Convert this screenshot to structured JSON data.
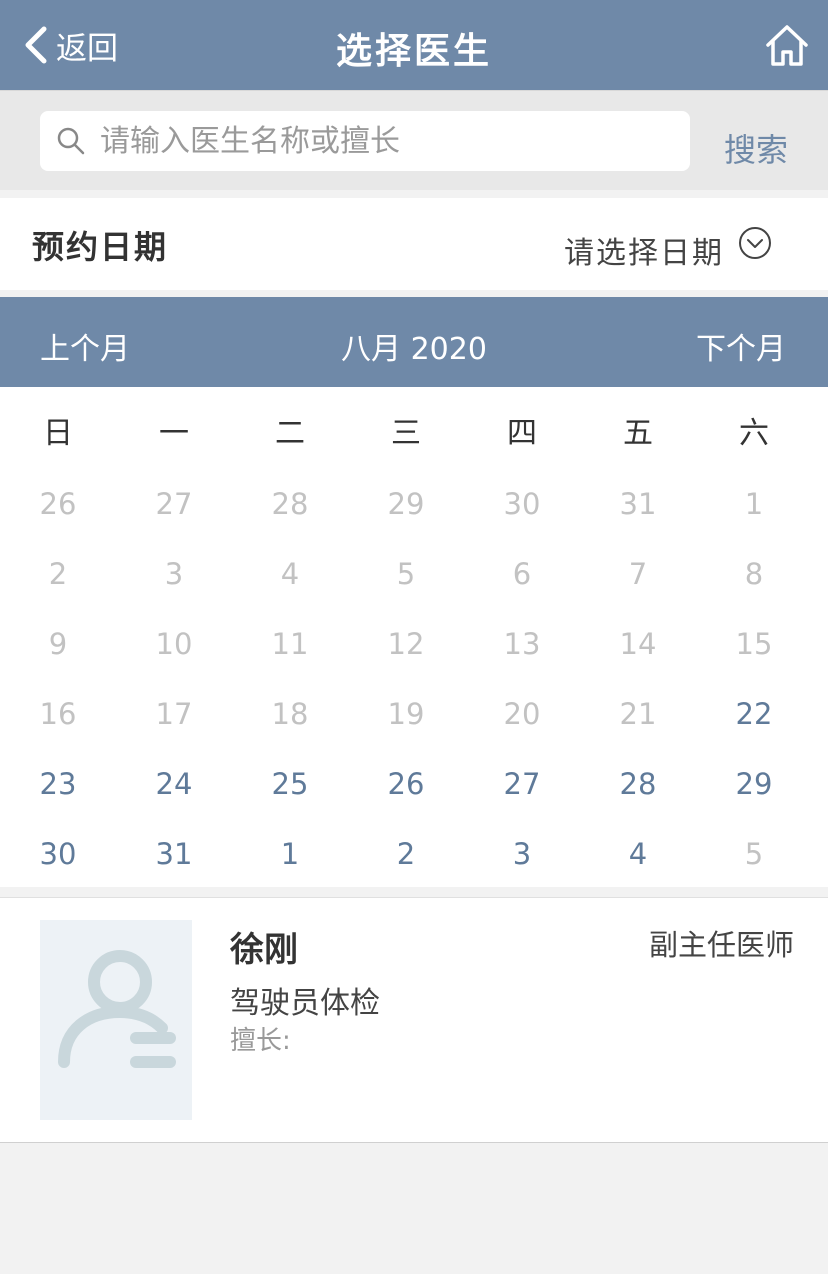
{
  "nav": {
    "back_label": "返回",
    "title": "选择医生"
  },
  "search": {
    "placeholder": "请输入医生名称或擅长",
    "value": "",
    "button_label": "搜索"
  },
  "appointment": {
    "label": "预约日期",
    "select_label": "请选择日期"
  },
  "calendar": {
    "prev_label": "上个月",
    "month_label": "八月 2020",
    "next_label": "下个月",
    "weekdays": [
      "日",
      "一",
      "二",
      "三",
      "四",
      "五",
      "六"
    ],
    "weeks": [
      [
        {
          "d": "26",
          "a": false
        },
        {
          "d": "27",
          "a": false
        },
        {
          "d": "28",
          "a": false
        },
        {
          "d": "29",
          "a": false
        },
        {
          "d": "30",
          "a": false
        },
        {
          "d": "31",
          "a": false
        },
        {
          "d": "1",
          "a": false
        }
      ],
      [
        {
          "d": "2",
          "a": false
        },
        {
          "d": "3",
          "a": false
        },
        {
          "d": "4",
          "a": false
        },
        {
          "d": "5",
          "a": false
        },
        {
          "d": "6",
          "a": false
        },
        {
          "d": "7",
          "a": false
        },
        {
          "d": "8",
          "a": false
        }
      ],
      [
        {
          "d": "9",
          "a": false
        },
        {
          "d": "10",
          "a": false
        },
        {
          "d": "11",
          "a": false
        },
        {
          "d": "12",
          "a": false
        },
        {
          "d": "13",
          "a": false
        },
        {
          "d": "14",
          "a": false
        },
        {
          "d": "15",
          "a": false
        }
      ],
      [
        {
          "d": "16",
          "a": false
        },
        {
          "d": "17",
          "a": false
        },
        {
          "d": "18",
          "a": false
        },
        {
          "d": "19",
          "a": false
        },
        {
          "d": "20",
          "a": false
        },
        {
          "d": "21",
          "a": false
        },
        {
          "d": "22",
          "a": true
        }
      ],
      [
        {
          "d": "23",
          "a": true
        },
        {
          "d": "24",
          "a": true
        },
        {
          "d": "25",
          "a": true
        },
        {
          "d": "26",
          "a": true
        },
        {
          "d": "27",
          "a": true
        },
        {
          "d": "28",
          "a": true
        },
        {
          "d": "29",
          "a": true
        }
      ],
      [
        {
          "d": "30",
          "a": true
        },
        {
          "d": "31",
          "a": true
        },
        {
          "d": "1",
          "a": true
        },
        {
          "d": "2",
          "a": true
        },
        {
          "d": "3",
          "a": true
        },
        {
          "d": "4",
          "a": true
        },
        {
          "d": "5",
          "a": false
        }
      ]
    ]
  },
  "doctors": [
    {
      "name": "徐刚",
      "title": "副主任医师",
      "department": "驾驶员体检",
      "specialty_label": "擅长:"
    }
  ],
  "icons": {
    "back": "chevron-left-icon",
    "home": "home-icon",
    "search": "search-icon",
    "dropdown": "chevron-down-circle-icon",
    "avatar": "user-avatar-icon"
  },
  "colors": {
    "primary": "#6f89a8",
    "active_day": "#5f7a99",
    "inactive_day": "#c2c2c2"
  }
}
